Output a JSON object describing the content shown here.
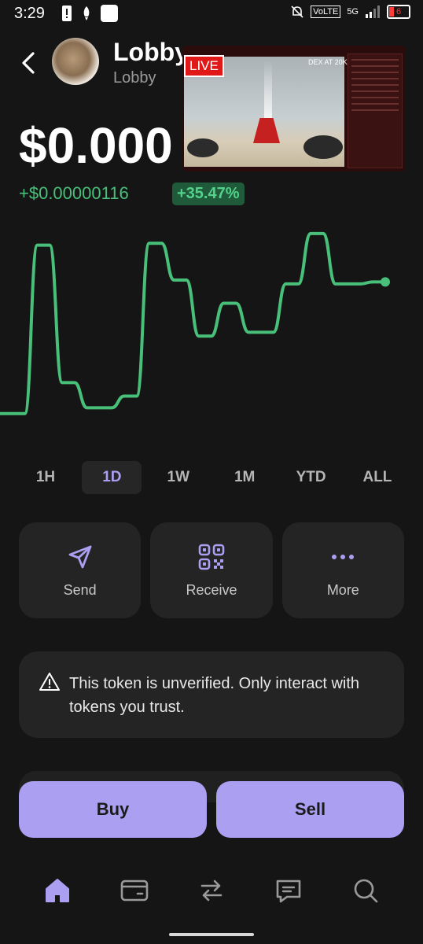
{
  "status_bar": {
    "time": "3:29",
    "network": "VoLTE",
    "signal": "5G",
    "battery": "6"
  },
  "header": {
    "token_name": "Lobby",
    "token_subtitle": "Lobby",
    "back_icon": "chevron-left-icon"
  },
  "price": {
    "value": "$0.000",
    "change": "+$0.00000116",
    "change_pct": "+35.47%",
    "up_color": "#48c07a"
  },
  "stream": {
    "live_label": "LIVE",
    "dex_text": "DEX AT 20K"
  },
  "chart_data": {
    "type": "line",
    "color": "#48c07a",
    "y": [
      0.05,
      0.05,
      0.05,
      0.92,
      0.92,
      0.21,
      0.21,
      0.08,
      0.08,
      0.08,
      0.14,
      0.14,
      0.93,
      0.93,
      0.74,
      0.74,
      0.45,
      0.45,
      0.62,
      0.62,
      0.47,
      0.47,
      0.47,
      0.72,
      0.72,
      0.98,
      0.98,
      0.72,
      0.72,
      0.72,
      0.73,
      0.73
    ],
    "title": "",
    "xlabel": "",
    "ylabel": ""
  },
  "timeframes": [
    {
      "label": "1H",
      "active": false
    },
    {
      "label": "1D",
      "active": true
    },
    {
      "label": "1W",
      "active": false
    },
    {
      "label": "1M",
      "active": false
    },
    {
      "label": "YTD",
      "active": false
    },
    {
      "label": "ALL",
      "active": false
    }
  ],
  "actions": {
    "send": "Send",
    "receive": "Receive",
    "more": "More",
    "accent": "#ab9ff2"
  },
  "warning": {
    "text": "This token is unverified. Only interact with tokens you trust."
  },
  "trade": {
    "buy": "Buy",
    "sell": "Sell"
  },
  "nav": [
    "home-icon",
    "wallet-card-icon",
    "swap-icon",
    "chat-icon",
    "search-icon"
  ]
}
